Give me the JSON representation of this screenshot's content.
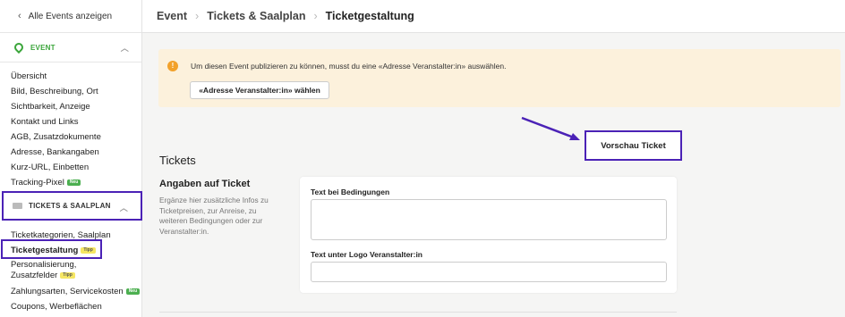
{
  "sidebar": {
    "back_label": "Alle Events anzeigen",
    "event_section": "EVENT",
    "event_items": [
      {
        "label": "Übersicht"
      },
      {
        "label": "Bild, Beschreibung, Ort"
      },
      {
        "label": "Sichtbarkeit, Anzeige"
      },
      {
        "label": "Kontakt und Links"
      },
      {
        "label": "AGB, Zusatzdokumente"
      },
      {
        "label": "Adresse, Bankangaben"
      },
      {
        "label": "Kurz-URL, Einbetten"
      },
      {
        "label": "Tracking-Pixel",
        "badge": "Neu"
      }
    ],
    "ticket_section": "TICKETS & SAALPLAN",
    "ticket_items": [
      {
        "label": "Ticketkategorien, Saalplan"
      },
      {
        "label": "Ticketgestaltung",
        "badge": "Tipp"
      },
      {
        "label": "Personalisierung,",
        "label2": "Zusatzfelder",
        "badge": "Tipp"
      },
      {
        "label": "Zahlungsarten, Servicekosten",
        "badge": "Neu"
      },
      {
        "label": "Coupons, Werbeflächen"
      }
    ]
  },
  "breadcrumb": {
    "items": [
      "Event",
      "Tickets & Saalplan"
    ],
    "current": "Ticketgestaltung"
  },
  "warning": {
    "text": "Um diesen Event publizieren zu können, musst du eine «Adresse Veranstalter:in» auswählen.",
    "button": "«Adresse Veranstalter:in» wählen"
  },
  "preview_button": "Vorschau Ticket",
  "main": {
    "title": "Tickets",
    "subtitle": "Angaben auf Ticket",
    "description": "Ergänze hier zusätzliche Infos zu Ticketpreisen, zur Anreise, zu weiteren Bedingungen oder zur Veranstalter:in.",
    "field1_label": "Text bei Bedingungen",
    "field1_value": "",
    "field2_label": "Text unter Logo Veranstalter:in",
    "field2_value": ""
  },
  "colors": {
    "accent_green": "#3aa53a",
    "highlight_purple": "#4b22b6",
    "warning_bg": "#fcf1dc",
    "warning_icon": "#f2a12a"
  }
}
